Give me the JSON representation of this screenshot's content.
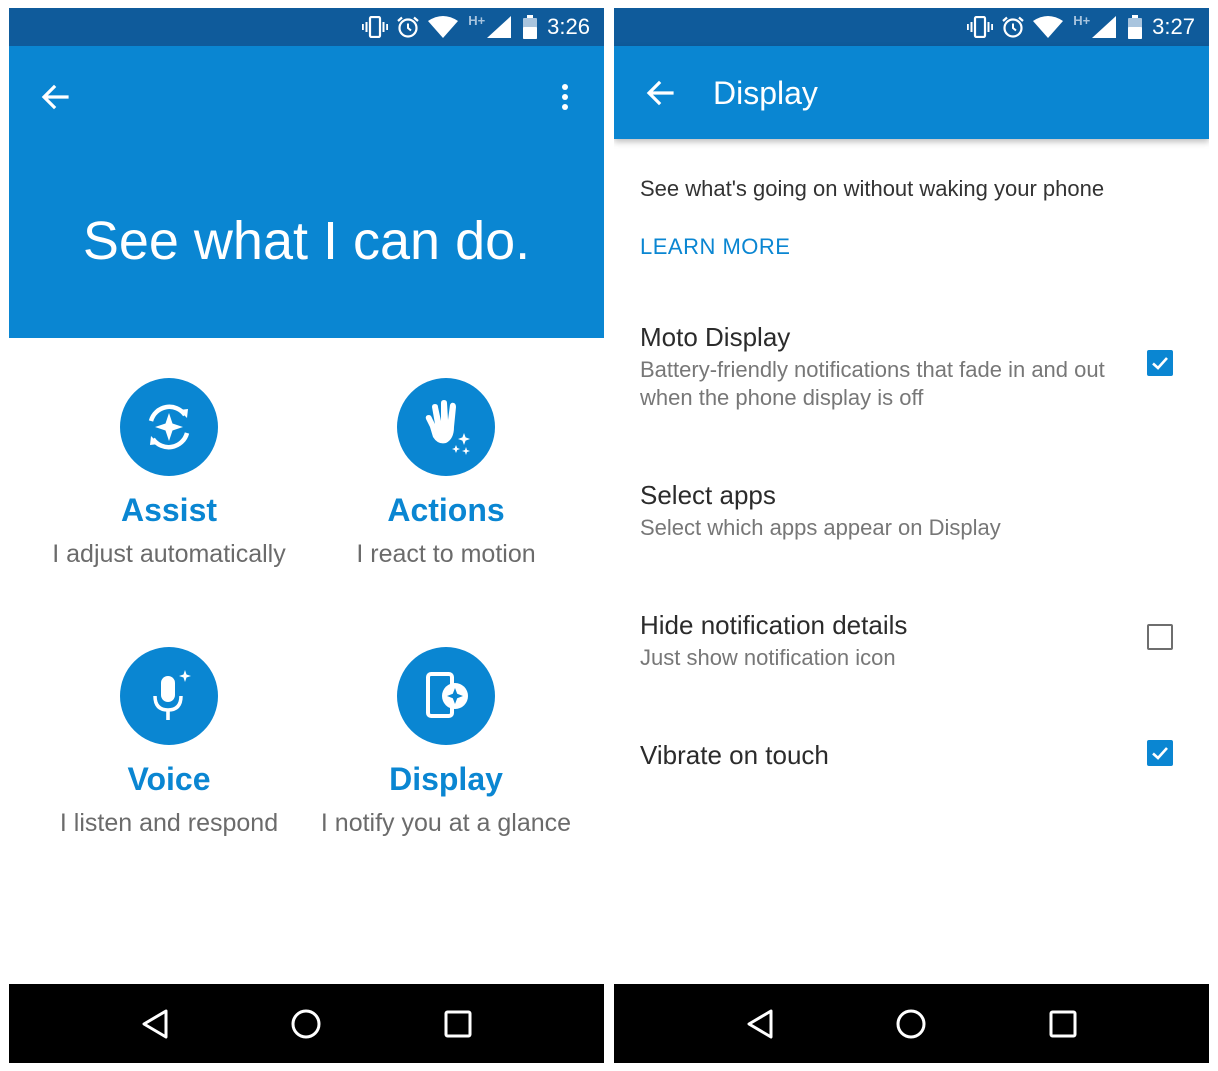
{
  "left_screen": {
    "status": {
      "network": "H+",
      "time": "3:26"
    },
    "hero_title": "See what I can do.",
    "features": [
      {
        "title": "Assist",
        "description": "I adjust automatically"
      },
      {
        "title": "Actions",
        "description": "I react to motion"
      },
      {
        "title": "Voice",
        "description": "I listen and respond"
      },
      {
        "title": "Display",
        "description": "I notify you at a glance"
      }
    ]
  },
  "right_screen": {
    "status": {
      "network": "H+",
      "time": "3:27"
    },
    "title": "Display",
    "intro": "See what's going on without waking your phone",
    "learn_more": "LEARN MORE",
    "settings": [
      {
        "title": "Moto Display",
        "subtitle": "Battery-friendly notifications that fade in and out when the phone display is off",
        "checked": true
      },
      {
        "title": "Select apps",
        "subtitle": "Select which apps appear on Display"
      },
      {
        "title": "Hide notification details",
        "subtitle": "Just show notification icon",
        "checked": false
      },
      {
        "title": "Vibrate on touch",
        "checked": true
      }
    ]
  },
  "icons": {
    "status": [
      "vibrate-icon",
      "alarm-icon",
      "wifi-icon",
      "signal-icon",
      "battery-icon"
    ],
    "navigation": [
      "back-nav-icon",
      "home-nav-icon",
      "recents-nav-icon"
    ],
    "features": [
      "assist-icon",
      "actions-hand-icon",
      "voice-mic-icon",
      "display-phone-icon"
    ]
  },
  "colors": {
    "primary": "#0a86d2",
    "status_bar": "#0f5b9b",
    "nav_bar": "#000000"
  }
}
